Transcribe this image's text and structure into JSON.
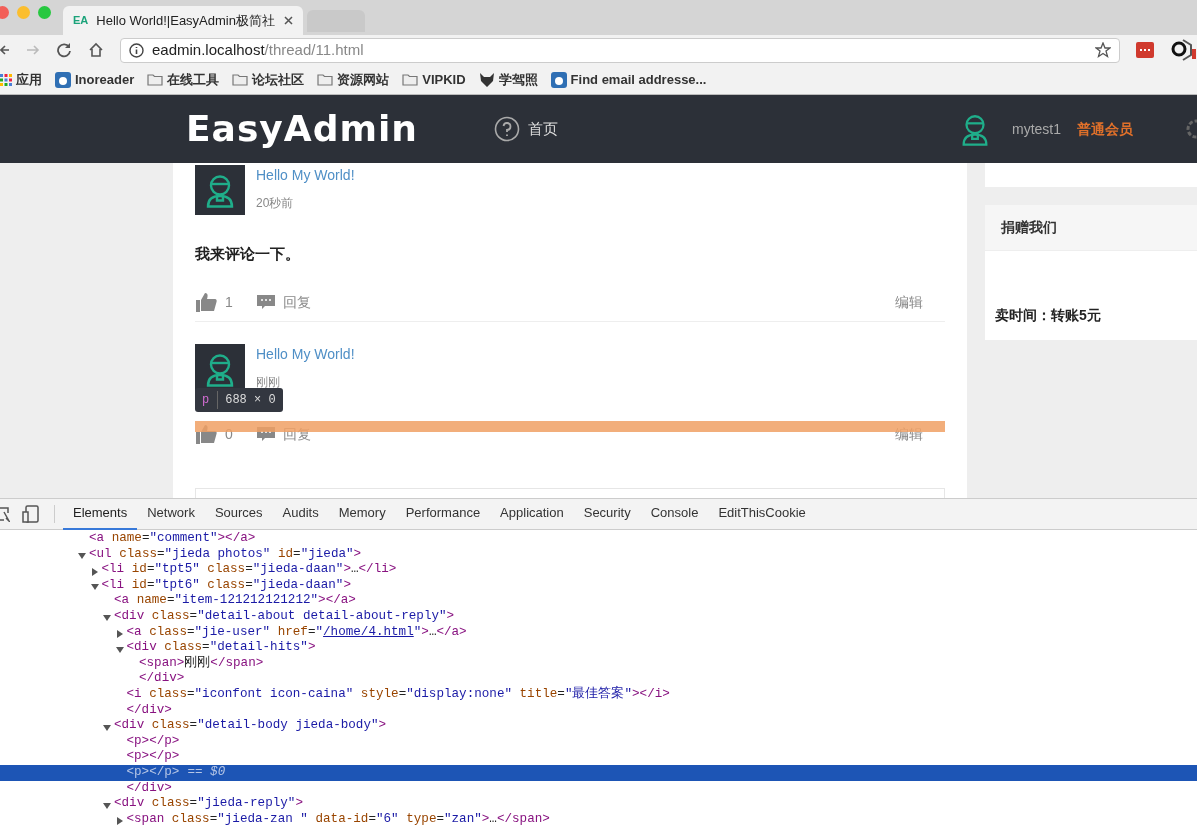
{
  "browser": {
    "tabs": [
      {
        "favicon": "EA",
        "title": "Hello World!|EasyAdmin极简社",
        "selected": true
      },
      {
        "selected": false
      }
    ],
    "address": {
      "host": "eadmin.localhost",
      "path": "/thread/11.html"
    },
    "bookmarks": [
      {
        "kind": "apps",
        "label": "应用"
      },
      {
        "kind": "app",
        "label": "Inoreader"
      },
      {
        "kind": "folder",
        "label": "在线工具"
      },
      {
        "kind": "folder",
        "label": "论坛社区"
      },
      {
        "kind": "folder",
        "label": "资源网站"
      },
      {
        "kind": "folder",
        "label": "VIPKID"
      },
      {
        "kind": "fox",
        "label": "学驾照"
      },
      {
        "kind": "app",
        "label": "Find email addresse..."
      }
    ]
  },
  "site": {
    "logo": "EasyAdmin",
    "nav": [
      {
        "label": "首页"
      }
    ],
    "user": {
      "name": "mytest1",
      "role": "普通会员"
    }
  },
  "comments": [
    {
      "author": "Hello My World!",
      "time": "20秒前",
      "body": "我来评论一下。",
      "likes": "1",
      "reply": "回复",
      "edit": "编辑"
    },
    {
      "author": "Hello My World!",
      "time": "刚刚",
      "likes": "0",
      "reply": "回复",
      "edit": "编辑"
    }
  ],
  "inspector_tooltip": {
    "tag": "p",
    "size": "688 × 0"
  },
  "sidebar": {
    "panels": [
      {
        "title": "捐赠我们",
        "body": "卖时间：转账5元"
      }
    ]
  },
  "devtools": {
    "tabs": [
      {
        "label": "Elements",
        "selected": true
      },
      {
        "label": "Network",
        "selected": false
      },
      {
        "label": "Sources",
        "selected": false
      },
      {
        "label": "Audits",
        "selected": false
      },
      {
        "label": "Memory",
        "selected": false
      },
      {
        "label": "Performance",
        "selected": false
      },
      {
        "label": "Application",
        "selected": false
      },
      {
        "label": "Security",
        "selected": false
      },
      {
        "label": "Console",
        "selected": false
      },
      {
        "label": "EditThisCookie",
        "selected": false
      }
    ],
    "dom": [
      {
        "text": "<a name=\"comment\"></a>",
        "selected": false
      },
      {
        "text": "<ul class=\"jieda photos\" id=\"jieda\">",
        "selected": false,
        "expanded": true,
        "children": [
          {
            "text": "<li id=\"tpt5\" class=\"jieda-daan\">…</li>",
            "selected": false,
            "expanded": false
          },
          {
            "text": "<li id=\"tpt6\" class=\"jieda-daan\">",
            "selected": false,
            "expanded": true,
            "children": [
              {
                "text": "<a name=\"item-121212121212\"></a>",
                "selected": false
              },
              {
                "text": "<div class=\"detail-about detail-about-reply\">",
                "selected": false,
                "expanded": true,
                "close": "</div>",
                "children": [
                  {
                    "segments": [
                      {
                        "text": "<a class=\"jie-user\" href=\""
                      },
                      {
                        "text": "/home/4.html",
                        "link": true
                      },
                      {
                        "text": "\">…</a>"
                      }
                    ],
                    "selected": false,
                    "expanded": false
                  },
                  {
                    "text": "<div class=\"detail-hits\">",
                    "selected": false,
                    "expanded": true,
                    "close": "</div>",
                    "children": [
                      {
                        "text": "<span>刚刚</span>",
                        "selected": false
                      }
                    ]
                  },
                  {
                    "text": "<i class=\"iconfont icon-caina\" style=\"display:none\" title=\"最佳答案\"></i>",
                    "selected": false
                  }
                ]
              },
              {
                "text": "<div class=\"detail-body jieda-body\">",
                "selected": false,
                "expanded": true,
                "close": "</div>",
                "children": [
                  {
                    "text": "<p></p>",
                    "selected": false
                  },
                  {
                    "text": "<p></p>",
                    "selected": false
                  },
                  {
                    "text": "<p></p>",
                    "marker": "== $0",
                    "selected": true
                  }
                ]
              },
              {
                "text": "<div class=\"jieda-reply\">",
                "selected": false,
                "expanded": true,
                "children": [
                  {
                    "text": "<span class=\"jieda-zan \" data-id=\"6\" type=\"zan\">…</span>",
                    "selected": false,
                    "expanded": false
                  }
                ]
              }
            ]
          }
        ]
      }
    ]
  }
}
